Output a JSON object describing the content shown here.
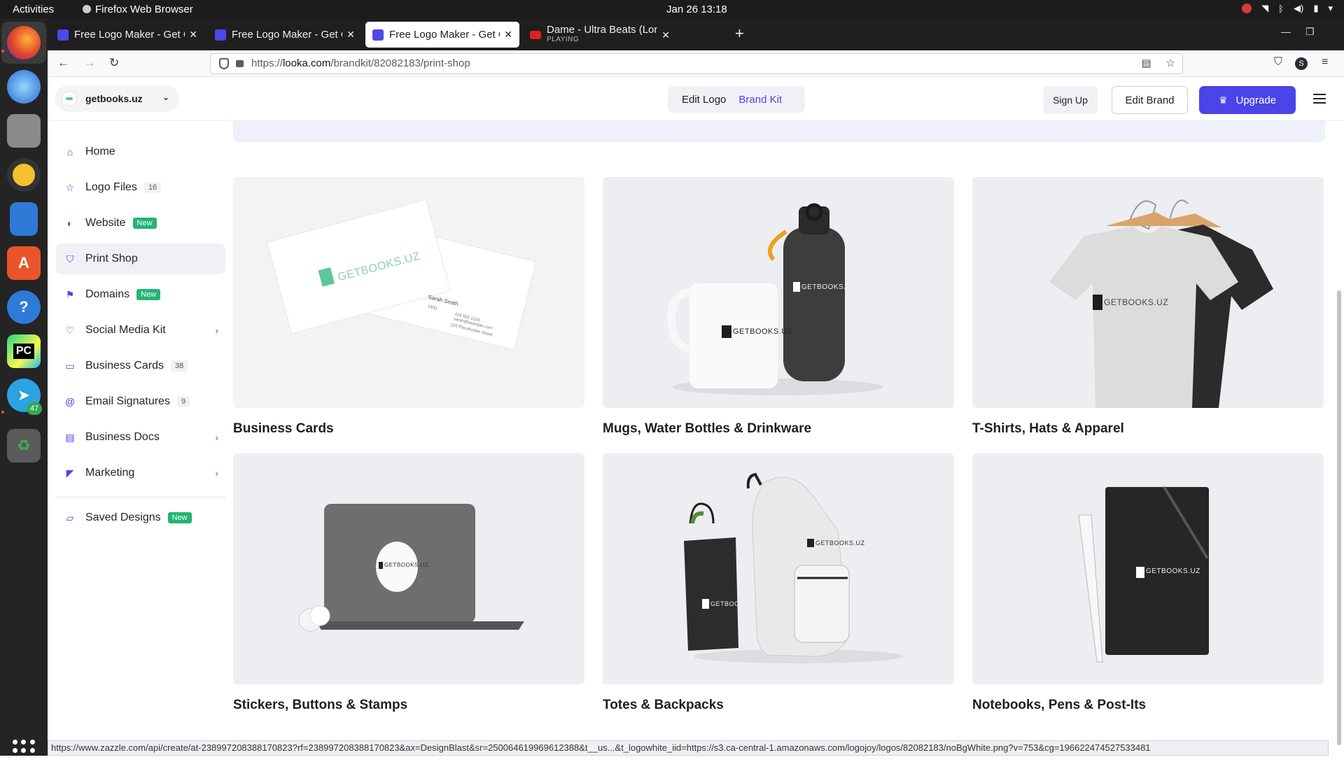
{
  "system": {
    "activities": "Activities",
    "app_name": "Firefox Web Browser",
    "clock": "Jan 26  13:18"
  },
  "dock": {
    "telegram_badge": "47"
  },
  "browser": {
    "tabs": [
      {
        "title": "Free Logo Maker - Get Cu"
      },
      {
        "title": "Free Logo Maker - Get Cu"
      },
      {
        "title": "Free Logo Maker - Get Cu"
      },
      {
        "title": "Dame - Ultra Beats (Long",
        "subtitle": "PLAYING"
      }
    ],
    "url_prefix": "https://",
    "url_domain": "looka.com",
    "url_path": "/brandkit/82082183/print-shop",
    "status_url": "https://www.zazzle.com/api/create/at-238997208388170823?rf=238997208388170823&ax=DesignBlast&sr=250064619969612388&t__us...&t_logowhite_iid=https://s3.ca-central-1.amazonaws.com/logojoy/logos/82082183/noBgWhite.png?v=753&cg=196622474527533481"
  },
  "header": {
    "brand": "getbooks.uz",
    "tab_edit_logo": "Edit Logo",
    "tab_brand_kit": "Brand Kit",
    "sign_up": "Sign Up",
    "edit_brand": "Edit Brand",
    "upgrade": "Upgrade"
  },
  "sidebar": {
    "items": [
      {
        "label": "Home"
      },
      {
        "label": "Logo Files",
        "count": "16"
      },
      {
        "label": "Website",
        "badge": "New"
      },
      {
        "label": "Print Shop"
      },
      {
        "label": "Domains",
        "badge": "New"
      },
      {
        "label": "Social Media Kit"
      },
      {
        "label": "Business Cards",
        "count": "38"
      },
      {
        "label": "Email Signatures",
        "count": "9"
      },
      {
        "label": "Business Docs"
      },
      {
        "label": "Marketing"
      },
      {
        "label": "Saved Designs",
        "badge": "New"
      }
    ]
  },
  "products": [
    {
      "title": "Business Cards"
    },
    {
      "title": "Mugs, Water Bottles & Drinkware"
    },
    {
      "title": "T-Shirts, Hats & Apparel"
    },
    {
      "title": "Stickers, Buttons & Stamps"
    },
    {
      "title": "Totes & Backpacks"
    },
    {
      "title": "Notebooks, Pens & Post-Its"
    }
  ],
  "mockup": {
    "wordmark": "GETBOOKS.UZ",
    "card_name": "Sarah Smith",
    "card_role": "CEO",
    "card_phone": "416 555 1234",
    "card_email": "sarah@example.com",
    "card_address": "123 Placeholder Street"
  },
  "colors": {
    "accent": "#4b44e8",
    "new_badge": "#22b574",
    "brand_green": "#5cc89a"
  }
}
